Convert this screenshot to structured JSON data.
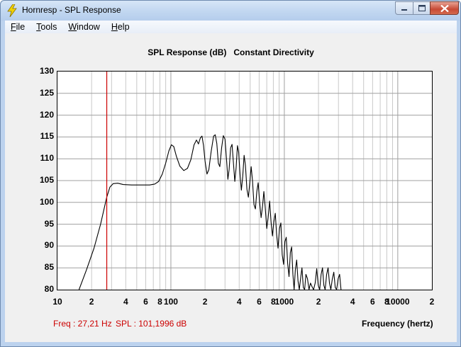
{
  "window": {
    "title": "Hornresp - SPL Response",
    "app_icon": "lightning-icon",
    "controls": [
      "minimize-icon",
      "maximize-icon",
      "close-icon"
    ]
  },
  "menu": {
    "items": [
      {
        "label": "File",
        "underline": "F"
      },
      {
        "label": "Tools",
        "underline": "T"
      },
      {
        "label": "Window",
        "underline": "W"
      },
      {
        "label": "Help",
        "underline": "H"
      }
    ]
  },
  "readout": {
    "freq": "Freq : 27,21 Hz",
    "spl": "SPL : 101,1996 dB"
  },
  "colors": {
    "marker": "#cc0000",
    "curve": "#000000",
    "grid": "#c8c8c8",
    "grid_major": "#a0a0a0"
  },
  "chart_data": {
    "type": "line",
    "title": "SPL Response (dB)   Constant Directivity",
    "xlabel": "Frequency (hertz)",
    "ylabel": "",
    "x_scale": "log",
    "xlim": [
      10,
      20000
    ],
    "ylim": [
      80,
      130
    ],
    "y_ticks": [
      "130",
      "125",
      "120",
      "115",
      "110",
      "105",
      "100",
      "95",
      "90",
      "85",
      "80"
    ],
    "x_ticks": [
      {
        "value": 10,
        "label": "10"
      },
      {
        "value": 20,
        "label": "2"
      },
      {
        "value": 40,
        "label": "4"
      },
      {
        "value": 60,
        "label": "6"
      },
      {
        "value": 80,
        "label": "8"
      },
      {
        "value": 100,
        "label": "100"
      },
      {
        "value": 200,
        "label": "2"
      },
      {
        "value": 400,
        "label": "4"
      },
      {
        "value": 600,
        "label": "6"
      },
      {
        "value": 800,
        "label": "8"
      },
      {
        "value": 1000,
        "label": "1000"
      },
      {
        "value": 2000,
        "label": "2"
      },
      {
        "value": 4000,
        "label": "4"
      },
      {
        "value": 6000,
        "label": "6"
      },
      {
        "value": 8000,
        "label": "8"
      },
      {
        "value": 10000,
        "label": "10000"
      },
      {
        "value": 20000,
        "label": "2"
      }
    ],
    "marker_x": 27.21,
    "series": [
      {
        "points": [
          [
            15.5,
            80
          ],
          [
            18,
            84.5
          ],
          [
            21,
            89.5
          ],
          [
            24,
            95
          ],
          [
            27.2,
            101.2
          ],
          [
            29,
            103.5
          ],
          [
            31,
            104.3
          ],
          [
            34,
            104.4
          ],
          [
            38,
            104.1
          ],
          [
            45,
            104
          ],
          [
            55,
            104
          ],
          [
            65,
            104
          ],
          [
            72,
            104.2
          ],
          [
            78,
            104.8
          ],
          [
            84,
            106.5
          ],
          [
            90,
            109
          ],
          [
            96,
            111.8
          ],
          [
            101,
            113.2
          ],
          [
            106,
            112.8
          ],
          [
            112,
            110.5
          ],
          [
            120,
            108.3
          ],
          [
            130,
            107.3
          ],
          [
            140,
            107.8
          ],
          [
            150,
            109.8
          ],
          [
            160,
            113.2
          ],
          [
            168,
            114.3
          ],
          [
            175,
            113.4
          ],
          [
            182,
            114.8
          ],
          [
            188,
            115.2
          ],
          [
            194,
            113
          ],
          [
            200,
            109.5
          ],
          [
            208,
            106.5
          ],
          [
            216,
            107.5
          ],
          [
            226,
            111.5
          ],
          [
            238,
            115.2
          ],
          [
            246,
            115.5
          ],
          [
            254,
            113.5
          ],
          [
            262,
            109
          ],
          [
            270,
            108.2
          ],
          [
            280,
            112.5
          ],
          [
            290,
            115.3
          ],
          [
            300,
            114.5
          ],
          [
            310,
            109.5
          ],
          [
            318,
            105.3
          ],
          [
            326,
            107.5
          ],
          [
            336,
            112.5
          ],
          [
            346,
            113.3
          ],
          [
            356,
            109
          ],
          [
            366,
            104.8
          ],
          [
            376,
            108
          ],
          [
            386,
            113
          ],
          [
            396,
            111.5
          ],
          [
            408,
            106
          ],
          [
            418,
            102.8
          ],
          [
            430,
            106
          ],
          [
            442,
            110.8
          ],
          [
            454,
            108.5
          ],
          [
            468,
            103
          ],
          [
            482,
            101.2
          ],
          [
            496,
            104.5
          ],
          [
            510,
            108.2
          ],
          [
            524,
            105
          ],
          [
            540,
            99.5
          ],
          [
            556,
            98.5
          ],
          [
            572,
            102.5
          ],
          [
            588,
            104.5
          ],
          [
            606,
            100
          ],
          [
            624,
            96.5
          ],
          [
            642,
            99
          ],
          [
            660,
            102.5
          ],
          [
            680,
            98.5
          ],
          [
            700,
            94
          ],
          [
            720,
            96.5
          ],
          [
            742,
            100.3
          ],
          [
            764,
            95.5
          ],
          [
            786,
            92.3
          ],
          [
            808,
            95.5
          ],
          [
            832,
            97.5
          ],
          [
            856,
            92.5
          ],
          [
            880,
            89.5
          ],
          [
            906,
            94
          ],
          [
            932,
            95.3
          ],
          [
            958,
            88
          ],
          [
            985,
            85.8
          ],
          [
            1012,
            91
          ],
          [
            1040,
            92
          ],
          [
            1070,
            86
          ],
          [
            1100,
            83
          ],
          [
            1130,
            88.5
          ],
          [
            1160,
            89.8
          ],
          [
            1190,
            83.5
          ],
          [
            1220,
            80
          ],
          [
            1250,
            84.5
          ],
          [
            1285,
            86.8
          ],
          [
            1320,
            82
          ],
          [
            1355,
            80
          ],
          [
            1390,
            82.5
          ],
          [
            1430,
            85
          ],
          [
            1470,
            80.5
          ],
          [
            1510,
            80
          ],
          [
            1550,
            83.5
          ],
          [
            1600,
            82.5
          ],
          [
            1650,
            80
          ],
          [
            1700,
            81.5
          ],
          [
            1760,
            80.6
          ],
          [
            1810,
            80
          ],
          [
            1870,
            81.5
          ],
          [
            1930,
            84.8
          ],
          [
            1990,
            81
          ],
          [
            2050,
            80
          ],
          [
            2110,
            83.5
          ],
          [
            2170,
            85
          ],
          [
            2230,
            81
          ],
          [
            2290,
            80
          ],
          [
            2360,
            83.5
          ],
          [
            2430,
            85
          ],
          [
            2500,
            81.5
          ],
          [
            2570,
            80
          ],
          [
            2650,
            82.5
          ],
          [
            2730,
            84
          ],
          [
            2810,
            80.5
          ],
          [
            2890,
            80
          ],
          [
            2980,
            82.5
          ],
          [
            3070,
            83.5
          ],
          [
            3160,
            80
          ]
        ]
      }
    ]
  }
}
